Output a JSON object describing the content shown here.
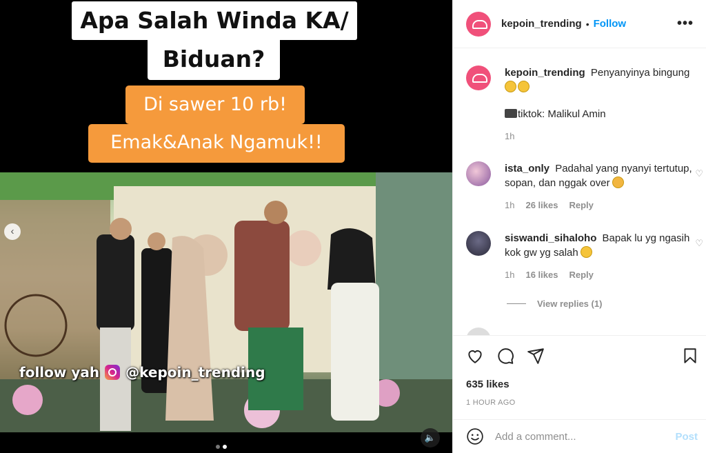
{
  "media": {
    "caption_line1": "Apa Salah Winda KA/",
    "caption_line2": "Biduan?",
    "caption_line3": "Di sawer 10 rb!",
    "caption_line4": "Emak&Anak Ngamuk!!",
    "overlay_text": "follow yah",
    "overlay_handle": "@kepoin_trending",
    "carousel_index": 2,
    "carousel_total": 2
  },
  "header": {
    "username": "kepoin_trending",
    "separator": "•",
    "follow_label": "Follow",
    "more_icon": "more-horizontal-icon"
  },
  "caption": {
    "username": "kepoin_trending",
    "text": "Penyanyinya bingung",
    "credit": "tiktok: Malikul Amin",
    "time": "1h"
  },
  "comments": [
    {
      "username": "ista_only",
      "text": "Padahal yang nyanyi tertutup, sopan, dan nggak over",
      "time": "1h",
      "likes": "26 likes",
      "reply": "Reply"
    },
    {
      "username": "siswandi_sihaloho",
      "text": "Bapak lu yg ngasih kok gw yg salah",
      "time": "1h",
      "likes": "16 likes",
      "reply": "Reply"
    }
  ],
  "view_replies": "View replies (1)",
  "actions": {
    "likes": "635 likes",
    "time_ago": "1 HOUR AGO"
  },
  "comment_box": {
    "placeholder": "Add a comment...",
    "post_label": "Post"
  },
  "colors": {
    "accent": "#0095f6",
    "post_disabled": "#b2dffc",
    "caption_orange": "#f59a3c",
    "brand_avatar": "#f0507a"
  }
}
